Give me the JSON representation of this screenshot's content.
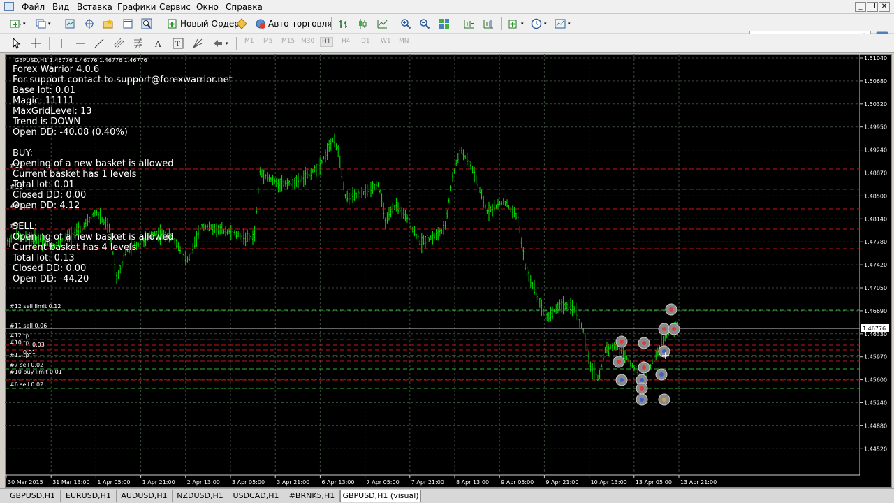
{
  "menu": [
    "Файл",
    "Вид",
    "Вставка",
    "Графики",
    "Сервис",
    "Окно",
    "Справка"
  ],
  "window_controls": {
    "minimize": "_",
    "restore": "❐",
    "close": "✕"
  },
  "toolbar": {
    "new_order": "Новый Ордер",
    "autotrading": "Авто-торговля"
  },
  "timeframes": [
    "M1",
    "M5",
    "M15",
    "M30",
    "H1",
    "H4",
    "D1",
    "W1",
    "MN"
  ],
  "active_timeframe": "H1",
  "search": {
    "placeholder": ""
  },
  "chart": {
    "symbol_header": "GBPUSD,H1  1.46776 1.46776 1.46776 1.46776",
    "info_lines": [
      "Forex Warrior 4.0.6",
      "For support contact to support@forexwarrior.net",
      "Base lot: 0.01",
      "Magic: 11111",
      "MaxGridLevel: 13",
      "Trend is DOWN",
      "Open DD:   -40.08 (0.40%)"
    ],
    "buy_block": [
      " BUY:",
      "Opening of a new basket is allowed",
      "Current basket has 1 levels",
      "Total lot: 0.01",
      "Closed DD: 0.00",
      "Open DD: 4.12"
    ],
    "sell_block": [
      " SELL:",
      "Opening of a new basket is allowed",
      "Current basket has 4 levels",
      "Total lot: 0.13",
      "Closed DD: 0.00",
      "Open DD: -44.20"
    ],
    "order_labels": [
      "#12 sell limit 0.12",
      "#11 sell 0.06",
      "#12 tp",
      "#10 tp",
      "0.03",
      "0.01",
      "#11 tp",
      "#7 sell 0.02",
      "#10 buy limit 0.01",
      "#6 sell 0.02"
    ],
    "overlay_labels": [
      "#12",
      "#13",
      "#6 tp",
      "#7"
    ],
    "price_labels": [
      "1.51040",
      "1.50680",
      "1.50320",
      "1.49950",
      "1.49240",
      "1.48870",
      "1.48500",
      "1.48140",
      "1.47780",
      "1.47420",
      "1.47050",
      "1.46690",
      "1.46330",
      "1.45970",
      "1.45600",
      "1.45240",
      "1.44880",
      "1.44520"
    ],
    "current_price": "1.46776",
    "time_labels": [
      "30 Mar 2015",
      "31 Mar 13:00",
      "1 Apr 05:00",
      "1 Apr 21:00",
      "2 Apr 13:00",
      "3 Apr 05:00",
      "3 Apr 21:00",
      "6 Apr 13:00",
      "7 Apr 05:00",
      "7 Apr 21:00",
      "8 Apr 13:00",
      "9 Apr 05:00",
      "9 Apr 21:00",
      "10 Apr 13:00",
      "13 Apr 05:00",
      "13 Apr 21:00"
    ],
    "colors": {
      "bg": "#000000",
      "candles": "#00e600",
      "grid": "#3a4a3a",
      "sell_line": "#c81414",
      "buy_line": "#32b432",
      "text": "#ffffff"
    }
  },
  "tabs": [
    "GBPUSD,H1",
    "EURUSD,H1",
    "AUDUSD,H1",
    "NZDUSD,H1",
    "USDCAD,H1",
    "#BRNK5,H1",
    "GBPUSD,H1 (visual)"
  ],
  "active_tab": 6
}
